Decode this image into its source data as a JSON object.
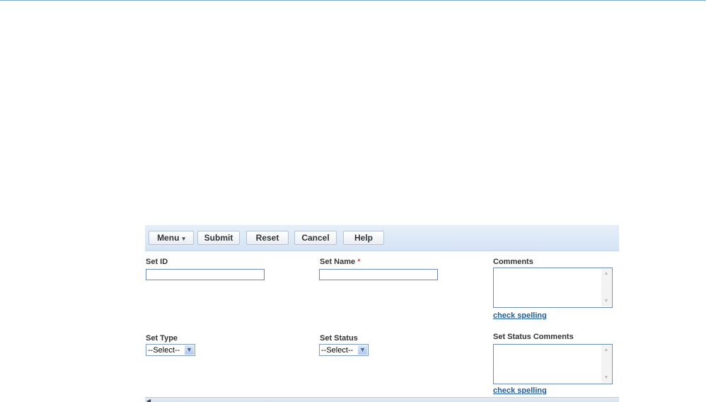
{
  "toolbar": {
    "menu_label": "Menu",
    "menu_arrow": "▾",
    "submit_label": "Submit",
    "reset_label": "Reset",
    "cancel_label": "Cancel",
    "help_label": "Help"
  },
  "form": {
    "set_id": {
      "label": "Set ID",
      "value": ""
    },
    "set_name": {
      "label": "Set Name",
      "required_mark": "*",
      "value": ""
    },
    "comments": {
      "label": "Comments",
      "spell_link": "check spelling"
    },
    "set_type": {
      "label": "Set Type",
      "selected": "--Select--"
    },
    "set_status": {
      "label": "Set Status",
      "selected": "--Select--"
    },
    "set_status_comments": {
      "label": "Set Status Comments",
      "spell_link": "check spelling"
    }
  },
  "icons": {
    "dropdown": "chevron-down-icon",
    "scroll_up": "scroll-up-icon",
    "scroll_down": "scroll-down-icon",
    "scroll_left": "scroll-left-icon"
  }
}
